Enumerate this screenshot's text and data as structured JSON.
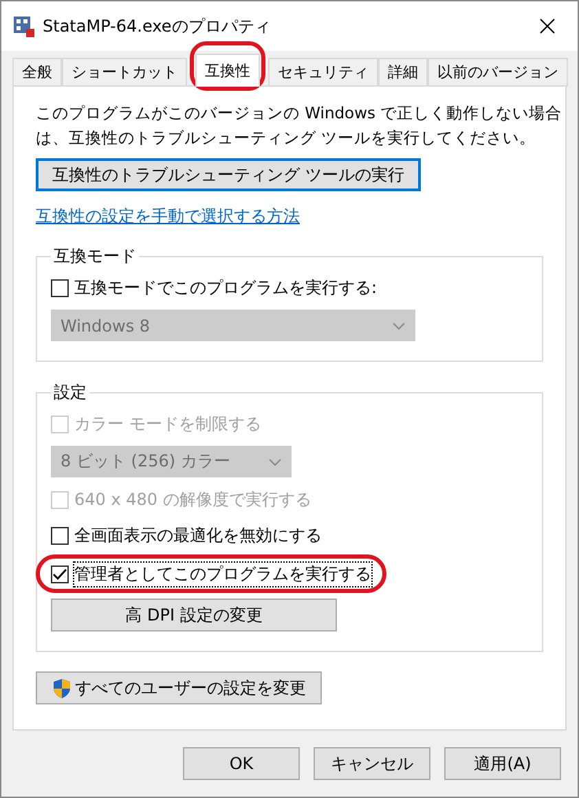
{
  "window": {
    "title": "StataMP-64.exeのプロパティ"
  },
  "tabs": [
    {
      "label": "全般",
      "selected": false,
      "highlighted": false
    },
    {
      "label": "ショートカット",
      "selected": false,
      "highlighted": false
    },
    {
      "label": "互換性",
      "selected": true,
      "highlighted": true
    },
    {
      "label": "セキュリティ",
      "selected": false,
      "highlighted": false
    },
    {
      "label": "詳細",
      "selected": false,
      "highlighted": false
    },
    {
      "label": "以前のバージョン",
      "selected": false,
      "highlighted": false
    }
  ],
  "description": "このプログラムがこのバージョンの Windows で正しく動作しない場合は、互換性のトラブルシューティング ツールを実行してください。",
  "troubleshoot_button": {
    "label": "互換性のトラブルシューティング ツールの実行",
    "default": true
  },
  "manual_link": "互換性の設定を手動で選択する方法",
  "compat_mode": {
    "title": "互換モード",
    "items": [
      {
        "kind": "checkbox",
        "label": "互換モードでこのプログラムを実行する:",
        "checked": false,
        "disabled": false,
        "focused": false,
        "highlighted": false
      },
      {
        "kind": "dropdown",
        "value": "Windows 8",
        "disabled": true
      }
    ]
  },
  "settings": {
    "title": "設定",
    "items": [
      {
        "kind": "checkbox",
        "label": "カラー モードを制限する",
        "checked": false,
        "disabled": true,
        "focused": false,
        "highlighted": false
      },
      {
        "kind": "dropdown",
        "value": "8 ビット (256) カラー",
        "disabled": true
      },
      {
        "kind": "checkbox",
        "label": "640 x 480 の解像度で実行する",
        "checked": false,
        "disabled": true,
        "focused": false,
        "highlighted": false
      },
      {
        "kind": "checkbox",
        "label": "全画面表示の最適化を無効にする",
        "checked": false,
        "disabled": false,
        "focused": false,
        "highlighted": false
      },
      {
        "kind": "checkbox",
        "label": "管理者としてこのプログラムを実行する",
        "checked": true,
        "disabled": false,
        "focused": true,
        "highlighted": true
      },
      {
        "kind": "button",
        "label": "高 DPI 設定の変更"
      }
    ]
  },
  "all_users_button": {
    "label": "すべてのユーザーの設定を変更"
  },
  "buttons": [
    "OK",
    "キャンセル",
    "適用(A)"
  ]
}
